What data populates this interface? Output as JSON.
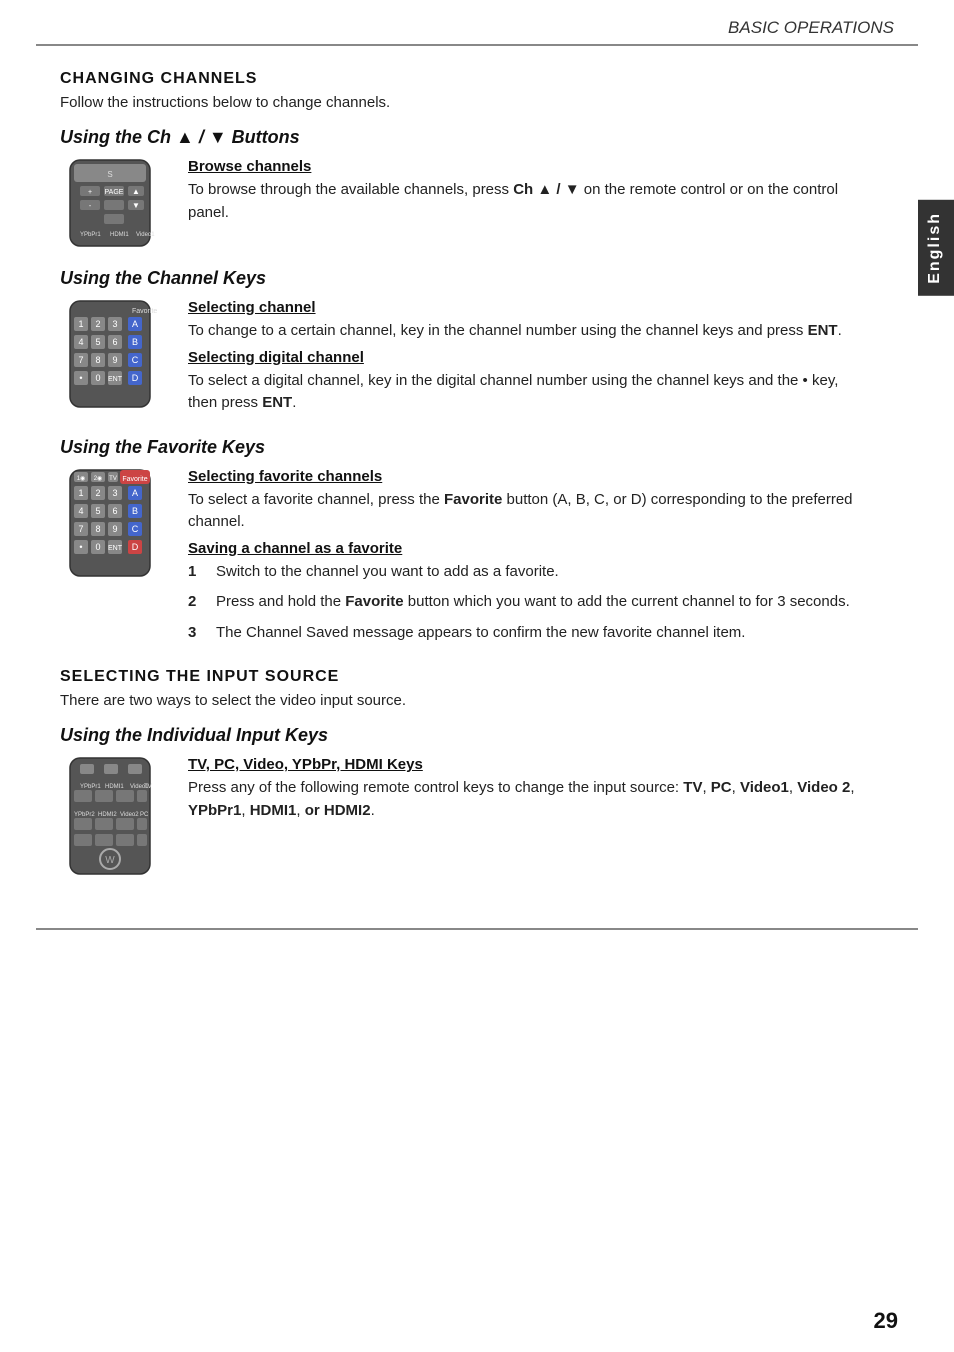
{
  "header": {
    "title": "BASIC OPERATIONS",
    "side_tab": "English"
  },
  "page_number": "29",
  "bottom_rule": true,
  "sections": [
    {
      "id": "changing-channels",
      "title": "CHANGING CHANNELS",
      "intro": "Follow the instructions below to change channels.",
      "subsections": [
        {
          "id": "ch-buttons",
          "heading": "Using the Ch ▲ / ▼ Buttons",
          "image_label": "ch-buttons-remote",
          "items": [
            {
              "id": "browse-channels",
              "link": "Browse channels",
              "body": "To browse through the available channels, press Ch ▲ / ▼ on the remote control or on the control panel.",
              "bold_parts": [
                "Ch ▲ / ▼"
              ]
            }
          ]
        },
        {
          "id": "channel-keys",
          "heading": "Using the Channel Keys",
          "image_label": "channel-keys-remote",
          "items": [
            {
              "id": "selecting-channel",
              "link": "Selecting channel",
              "body": "To change to a certain channel, key in the channel number using the channel keys and press ENT.",
              "bold_parts": [
                "ENT"
              ]
            },
            {
              "id": "selecting-digital-channel",
              "link": "Selecting digital channel",
              "body": "To select a digital channel, key in the digital channel number using the channel keys and the • key, then press ENT.",
              "bold_parts": [
                "ENT"
              ]
            }
          ]
        },
        {
          "id": "favorite-keys",
          "heading": "Using the Favorite Keys",
          "image_label": "favorite-keys-remote",
          "items": [
            {
              "id": "selecting-favorite-channels",
              "link": "Selecting favorite channels ",
              "body": "To select a favorite channel, press the Favorite button (A, B, C, or D) corresponding to the preferred channel.",
              "bold_parts": [
                "Favorite"
              ]
            },
            {
              "id": "saving-favorite",
              "link": "Saving a channel as a favorite",
              "numbered": [
                "Switch to the channel you want to add as a favorite.",
                "Press and hold the <b>Favorite</b> button which you want to add the current channel to for 3 seconds.",
                "The Channel Saved message appears to confirm the new favorite channel item."
              ]
            }
          ]
        }
      ]
    },
    {
      "id": "selecting-input-source",
      "title": "SELECTING THE INPUT SOURCE",
      "intro": "There are two ways to select the video input source.",
      "subsections": [
        {
          "id": "individual-input-keys",
          "heading": "Using the Individual Input Keys",
          "image_label": "input-keys-remote",
          "items": [
            {
              "id": "tv-pc-video-keys",
              "link": "TV, PC, Video, YPbPr, HDMI Keys",
              "body": "Press any of the following remote control keys to change the input source: TV, PC, Video1, Video 2, YPbPr1, HDMI1, or HDMI2.",
              "bold_parts": [
                "TV",
                "PC",
                "Video1",
                "Video 2",
                "YPbPr1",
                "HDMI1",
                "or HDMI2"
              ]
            }
          ]
        }
      ]
    }
  ]
}
